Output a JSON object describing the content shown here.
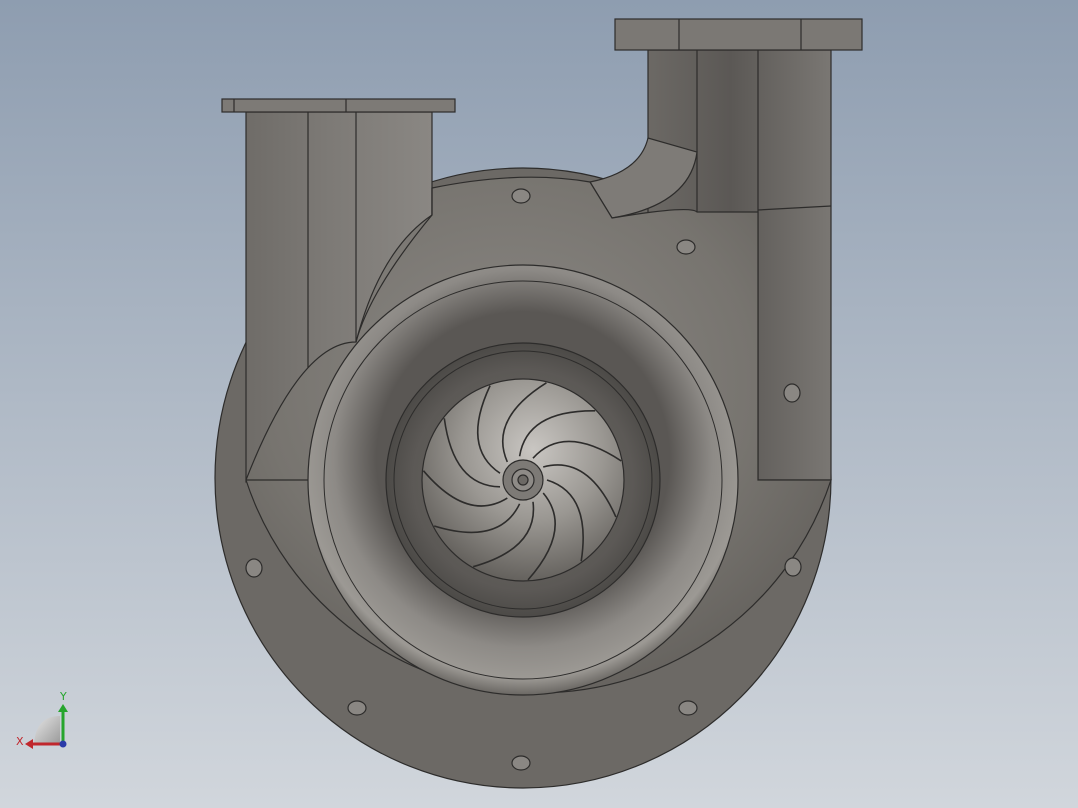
{
  "viewport": {
    "background_top": "#8e9db0",
    "background_bottom": "#d1d6dc",
    "model": {
      "part_name": "centrifugal-pump-volute",
      "body_color": "#76736f",
      "edge_color": "#2d2c2b",
      "impeller_color": "#8a8784"
    }
  },
  "triad": {
    "x_label": "X",
    "y_label": "Y",
    "x_color": "#c0272d",
    "y_color": "#26a52d",
    "z_color": "#2a3aa8"
  }
}
